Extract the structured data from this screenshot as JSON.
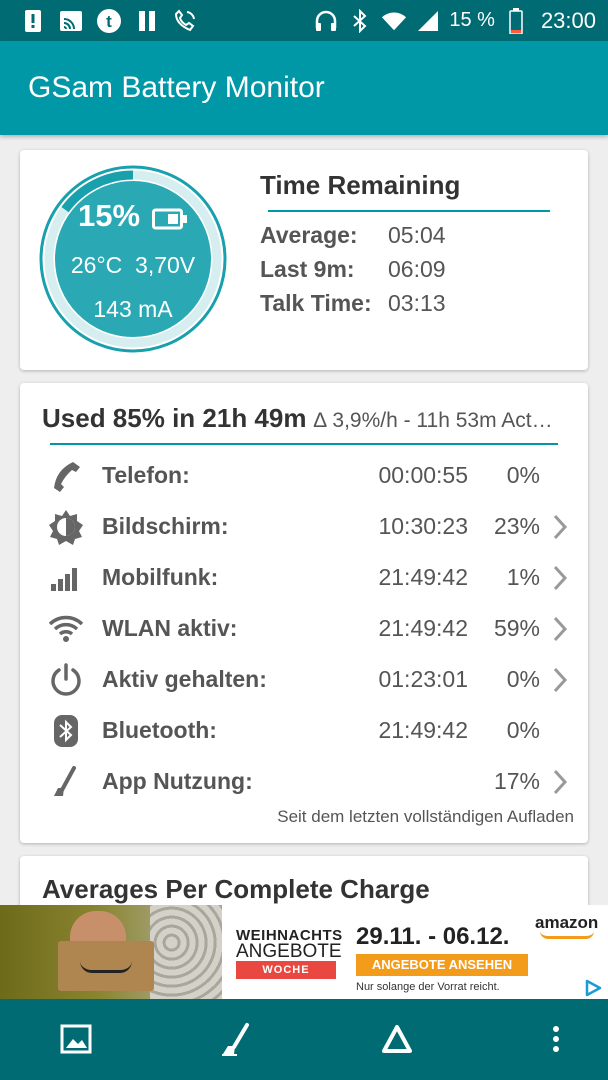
{
  "status_bar": {
    "icons_left": [
      "alert-icon",
      "cast-icon",
      "t-app-icon",
      "pause-icon",
      "wifi-call-icon"
    ],
    "icons_right": [
      "headset-icon",
      "bluetooth-icon",
      "wifi-icon",
      "signal-icon"
    ],
    "battery_percent": "15 %",
    "time": "23:00"
  },
  "app_bar": {
    "title": "GSam Battery Monitor"
  },
  "battery": {
    "level_percent": "15%",
    "level_fraction": 0.15,
    "temperature": "26°C",
    "voltage": "3,70V",
    "current": "143 mA"
  },
  "time_remaining": {
    "title": "Time Remaining",
    "rows": [
      {
        "label": "Average:",
        "value": "05:04"
      },
      {
        "label": "Last 9m:",
        "value": "06:09"
      },
      {
        "label": "Talk Time:",
        "value": "03:13"
      }
    ]
  },
  "usage": {
    "title": "Used 85% in 21h 49m",
    "subtitle": "∆ 3,9%/h - 11h 53m Act…",
    "rows": [
      {
        "icon": "phone-icon",
        "label": "Telefon:",
        "time": "00:00:55",
        "percent": "0%",
        "chevron": false
      },
      {
        "icon": "brightness-icon",
        "label": "Bildschirm:",
        "time": "10:30:23",
        "percent": "23%",
        "chevron": true
      },
      {
        "icon": "signal-bars-icon",
        "label": "Mobilfunk:",
        "time": "21:49:42",
        "percent": "1%",
        "chevron": true
      },
      {
        "icon": "wifi-icon",
        "label": "WLAN aktiv:",
        "time": "21:49:42",
        "percent": "59%",
        "chevron": true
      },
      {
        "icon": "power-icon",
        "label": "Aktiv gehalten:",
        "time": "01:23:01",
        "percent": "0%",
        "chevron": true
      },
      {
        "icon": "bluetooth-icon",
        "label": "Bluetooth:",
        "time": "21:49:42",
        "percent": "0%",
        "chevron": false
      },
      {
        "icon": "app-usage-icon",
        "label": "App Nutzung:",
        "time": "",
        "percent": "17%",
        "chevron": true
      }
    ],
    "footer": "Seit dem letzten vollständigen Aufladen"
  },
  "averages": {
    "title": "Averages Per Complete Charge"
  },
  "ad": {
    "headline_1": "WEIHNACHTS",
    "headline_2": "ANGEBOTE",
    "headline_3": "WOCHE",
    "date_range": "29.11. - 06.12.",
    "cta": "ANGEBOTE ANSEHEN",
    "note": "Nur solange der Vorrat reicht.",
    "brand": "amazon"
  },
  "bottom_nav": [
    "image-icon",
    "app-usage-icon",
    "delta-icon",
    "more-vert-icon"
  ],
  "colors": {
    "status_bar": "#006b73",
    "app_bar": "#0097a7",
    "accent": "#0097a7",
    "gauge_fill": "#2aa9b4",
    "background": "#eeeeee"
  }
}
